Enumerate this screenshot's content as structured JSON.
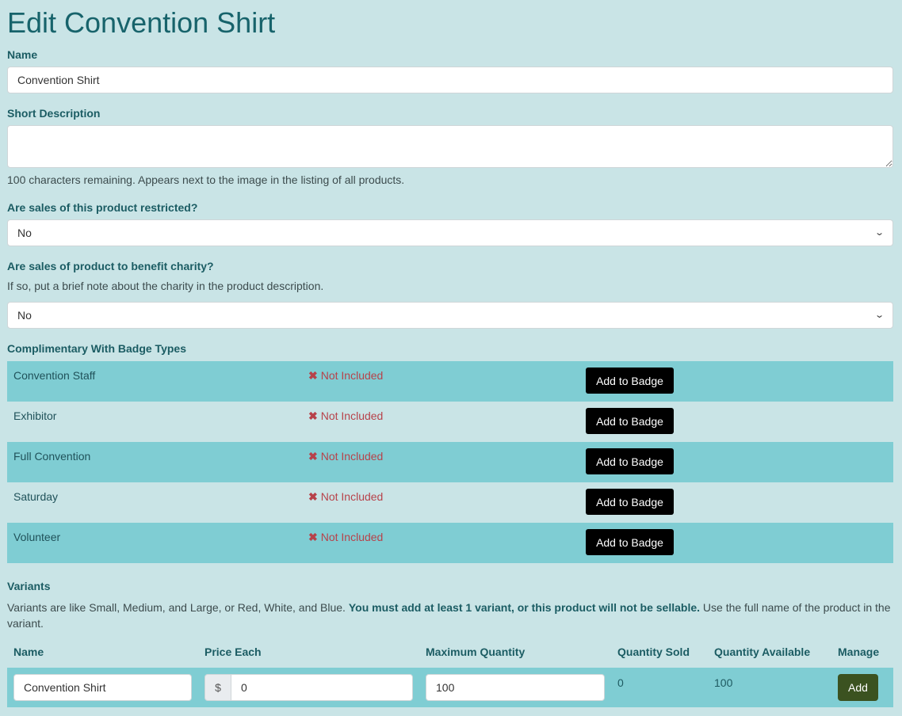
{
  "page": {
    "title": "Edit Convention Shirt"
  },
  "form": {
    "name_label": "Name",
    "name_value": "Convention Shirt",
    "short_desc_label": "Short Description",
    "short_desc_value": "",
    "short_desc_help": "100 characters remaining. Appears next to the image in the listing of all products.",
    "restricted_label": "Are sales of this product restricted?",
    "restricted_value": "No",
    "charity_label": "Are sales of product to benefit charity?",
    "charity_help": "If so, put a brief note about the charity in the product description.",
    "charity_value": "No"
  },
  "badges": {
    "label": "Complimentary With Badge Types",
    "button_label": "Add to Badge",
    "not_included_icon": "x-mark-icon",
    "rows": [
      {
        "name": "Convention Staff",
        "status": "Not Included"
      },
      {
        "name": "Exhibitor",
        "status": "Not Included"
      },
      {
        "name": "Full Convention",
        "status": "Not Included"
      },
      {
        "name": "Saturday",
        "status": "Not Included"
      },
      {
        "name": "Volunteer",
        "status": "Not Included"
      }
    ]
  },
  "variants": {
    "label": "Variants",
    "help_pre": "Variants are like Small, Medium, and Large, or Red, White, and Blue. ",
    "help_bold": "You must add at least 1 variant, or this product will not be sellable.",
    "help_post": " Use the full name of the product in the variant.",
    "columns": [
      "Name",
      "Price Each",
      "Maximum Quantity",
      "Quantity Sold",
      "Quantity Available",
      "Manage"
    ],
    "row": {
      "name": "Convention Shirt",
      "currency": "$",
      "price": "0",
      "max_qty": "100",
      "sold": "0",
      "available": "100",
      "action": "Add"
    }
  },
  "colors": {
    "background": "#c9e4e6",
    "stripe": "#7fcdd3",
    "heading": "#17636b",
    "not_included": "#b7424a",
    "add_button": "#3b5220"
  }
}
